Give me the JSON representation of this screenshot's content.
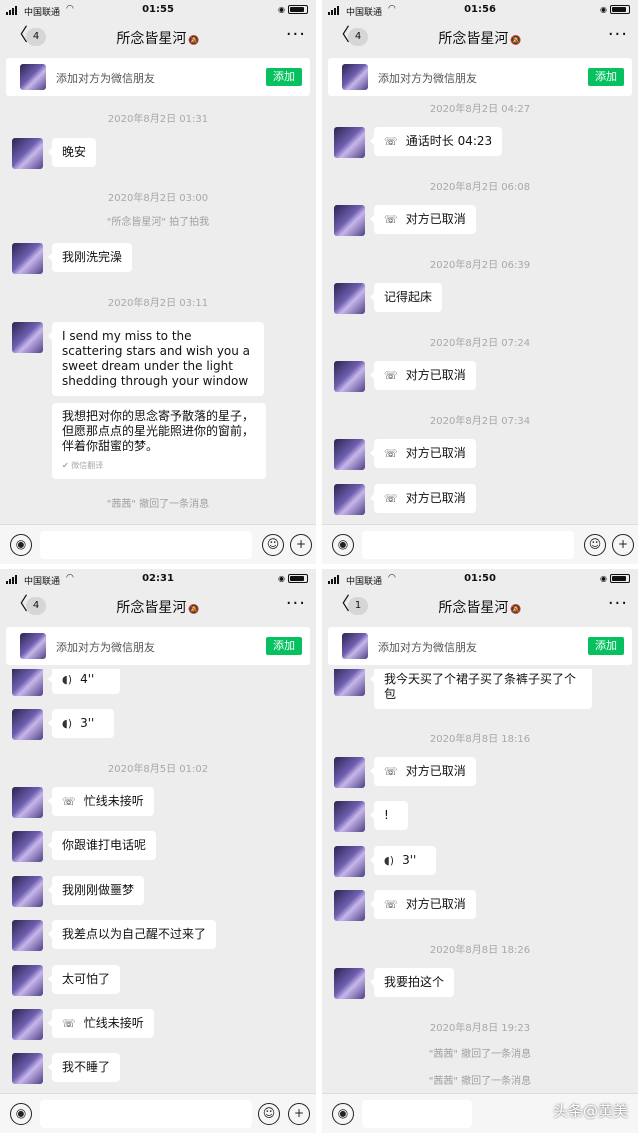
{
  "colors": {
    "accent": "#07c160",
    "panel_bg": "#ededed",
    "bubble": "#ffffff"
  },
  "icons": {
    "back": "chevron-left-icon",
    "more": "more-icon",
    "mute": "mute-icon",
    "voice": "voice-icon",
    "emoji": "emoji-icon",
    "plus": "plus-icon",
    "call": "phone-icon",
    "audio": "audio-wave-icon"
  },
  "panels": [
    {
      "status": {
        "carrier": "中国联通",
        "time": "01:55"
      },
      "nav": {
        "back": "〈",
        "badge": "4",
        "title": "所念皆星河",
        "more": "···"
      },
      "add_bar": {
        "text": "添加对方为微信朋友",
        "button": "添加"
      },
      "messages": [
        {
          "kind": "time",
          "text": "2020年8月2日 01:31"
        },
        {
          "kind": "text",
          "text": "晚安"
        },
        {
          "kind": "time",
          "text": "2020年8月2日 03:00"
        },
        {
          "kind": "system",
          "text": "\"所念皆星河\" 拍了拍我"
        },
        {
          "kind": "text",
          "text": "我刚洗完澡"
        },
        {
          "kind": "time",
          "text": "2020年8月2日 03:11"
        },
        {
          "kind": "text",
          "text": "I send my miss to the scattering stars and wish you a sweet dream under the light shedding through your window"
        },
        {
          "kind": "translation",
          "text": "我想把对你的思念寄予散落的星子，但愿那点点的星光能照进你的窗前，伴着你甜蜜的梦。",
          "label": "微信翻译"
        },
        {
          "kind": "system",
          "text": "\"茜茜\" 撤回了一条消息"
        }
      ]
    },
    {
      "status": {
        "carrier": "中国联通",
        "time": "01:56"
      },
      "nav": {
        "back": "〈",
        "badge": "4",
        "title": "所念皆星河",
        "more": "···"
      },
      "add_bar": {
        "text": "添加对方为微信朋友",
        "button": "添加"
      },
      "messages": [
        {
          "kind": "time",
          "text": "2020年8月2日 04:27"
        },
        {
          "kind": "call",
          "text": "通话时长 04:23"
        },
        {
          "kind": "time",
          "text": "2020年8月2日 06:08"
        },
        {
          "kind": "call",
          "text": "对方已取消"
        },
        {
          "kind": "time",
          "text": "2020年8月2日 06:39"
        },
        {
          "kind": "text",
          "text": "记得起床"
        },
        {
          "kind": "time",
          "text": "2020年8月2日 07:24"
        },
        {
          "kind": "call",
          "text": "对方已取消"
        },
        {
          "kind": "time",
          "text": "2020年8月2日 07:34"
        },
        {
          "kind": "call",
          "text": "对方已取消"
        },
        {
          "kind": "call",
          "text": "对方已取消"
        }
      ]
    },
    {
      "status": {
        "carrier": "中国联通",
        "time": "02:31"
      },
      "nav": {
        "back": "〈",
        "badge": "4",
        "title": "所念皆星河",
        "more": "···"
      },
      "add_bar": {
        "text": "添加对方为微信朋友",
        "button": "添加"
      },
      "messages": [
        {
          "kind": "voice",
          "text": "4''"
        },
        {
          "kind": "voice",
          "text": "3''"
        },
        {
          "kind": "time",
          "text": "2020年8月5日 01:02"
        },
        {
          "kind": "call",
          "text": "忙线未接听"
        },
        {
          "kind": "text",
          "text": "你跟谁打电话呢"
        },
        {
          "kind": "text",
          "text": "我刚刚做噩梦"
        },
        {
          "kind": "text",
          "text": "我差点以为自己醒不过来了"
        },
        {
          "kind": "text",
          "text": "太可怕了"
        },
        {
          "kind": "call",
          "text": "忙线未接听"
        },
        {
          "kind": "text",
          "text": "我不睡了"
        }
      ]
    },
    {
      "status": {
        "carrier": "中国联通",
        "time": "01:50"
      },
      "nav": {
        "back": "〈",
        "badge": "1",
        "title": "所念皆星河",
        "more": "···"
      },
      "add_bar": {
        "text": "添加对方为微信朋友",
        "button": "添加"
      },
      "messages": [
        {
          "kind": "text",
          "text": "我今天买了个裙子买了条裤子买了个包"
        },
        {
          "kind": "time",
          "text": "2020年8月8日 18:16"
        },
        {
          "kind": "call",
          "text": "对方已取消"
        },
        {
          "kind": "text",
          "text": "!"
        },
        {
          "kind": "voice",
          "text": "3''"
        },
        {
          "kind": "call",
          "text": "对方已取消"
        },
        {
          "kind": "time",
          "text": "2020年8月8日 18:26"
        },
        {
          "kind": "text",
          "text": "我要拍这个"
        },
        {
          "kind": "time",
          "text": "2020年8月8日 19:23"
        },
        {
          "kind": "system",
          "text": "\"茜茜\" 撤回了一条消息"
        },
        {
          "kind": "system",
          "text": "\"茜茜\" 撤回了一条消息"
        }
      ]
    }
  ],
  "watermark": "头条@黄美"
}
